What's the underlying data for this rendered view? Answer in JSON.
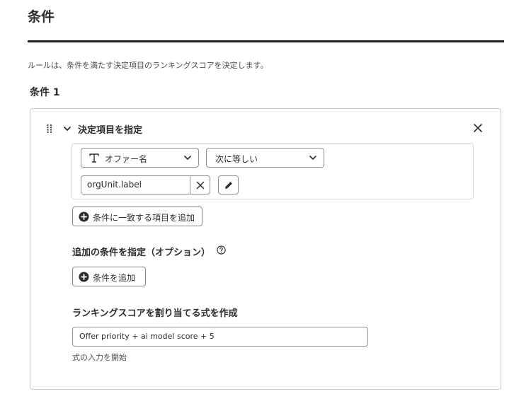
{
  "header": {
    "title": "条件",
    "description": "ルールは、条件を満たす決定項目のランキングスコアを決定します。"
  },
  "condition": {
    "label": "条件 1",
    "card_title": "決定項目を指定",
    "field_select": {
      "value": "オファー名",
      "icon": "text-type-icon"
    },
    "operator_select": {
      "value": "次に等しい"
    },
    "value_input": {
      "value": "orgUnit.label"
    },
    "add_matching_button": "条件に一致する項目を追加"
  },
  "optional": {
    "title": "追加の条件を指定（オプション）",
    "add_button": "条件を追加"
  },
  "ranking": {
    "title": "ランキングスコアを割り当てる式を作成",
    "expression": "Offer priority + ai model score + 5",
    "hint": "式の入力を開始"
  },
  "colors": {
    "text": "#2c2c2c",
    "rule": "#1f1f1f",
    "border": "#909090",
    "card_border": "#cacaca"
  }
}
